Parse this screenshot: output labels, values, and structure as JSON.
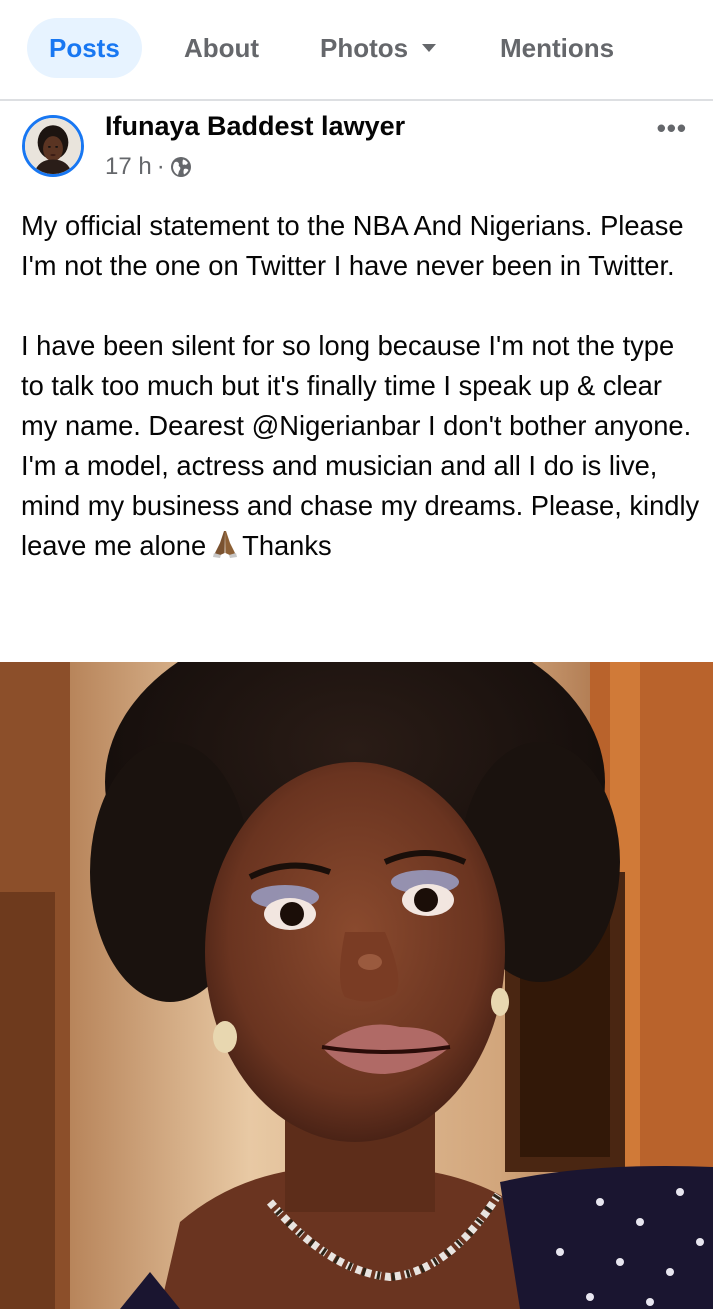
{
  "tabs": [
    {
      "label": "Posts",
      "active": true
    },
    {
      "label": "About"
    },
    {
      "label": "Photos",
      "has_dropdown": true
    },
    {
      "label": "Mentions"
    }
  ],
  "post": {
    "author": "Ifunaya Baddest lawyer",
    "time": "17 h",
    "separator": "·",
    "privacy_icon": "globe-icon",
    "more_icon": "•••",
    "text": {
      "paragraph_1": "My official statement to the NBA And Nigerians. Please I'm not the one on Twitter I have never been in Twitter.",
      "paragraph_2_before_emoji": "I have been silent for so long because I'm not the type to talk too much but it's finally time I speak up & clear my name. Dearest @Nigerianbar I don't bother anyone. I'm a model, actress and musician and all I do is live, mind my business and chase my dreams. Please, kindly leave me alone",
      "emoji": "folded-hands",
      "paragraph_2_after_emoji": "Thanks"
    }
  },
  "colors": {
    "accent": "#1877f2",
    "tab_active_bg": "#e7f3ff",
    "secondary_text": "#65676b",
    "primary_text": "#050505"
  }
}
